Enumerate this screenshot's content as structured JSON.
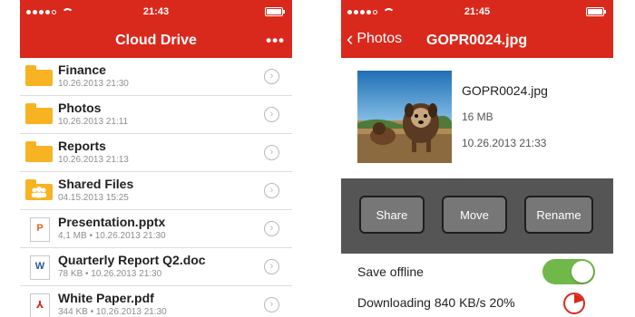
{
  "colors": {
    "accent": "#d9291c",
    "folder": "#f7b321",
    "toggle_on": "#71b84a",
    "action_bar": "#555555"
  },
  "left_screen": {
    "status": {
      "time": "21:43"
    },
    "nav": {
      "title": "Cloud Drive",
      "more_icon": "ellipsis-icon",
      "more_text": "•••"
    },
    "items": [
      {
        "name": "Finance",
        "meta": "10.26.2013 21:30",
        "icon": "folder-icon"
      },
      {
        "name": "Photos",
        "meta": "10.26.2013 21:11",
        "icon": "folder-icon"
      },
      {
        "name": "Reports",
        "meta": "10.26.2013 21:13",
        "icon": "folder-icon"
      },
      {
        "name": "Shared Files",
        "meta": "04.15.2013 15:25",
        "icon": "shared-folder-icon"
      },
      {
        "name": "Presentation.pptx",
        "meta": "4,1 MB • 10.26.2013 21:30",
        "icon": "powerpoint-file-icon",
        "badge": "P",
        "badge_color": "#e0621f"
      },
      {
        "name": "Quarterly Report Q2.doc",
        "meta": "78 KB • 10.26.2013 21:30",
        "icon": "word-file-icon",
        "badge": "W",
        "badge_color": "#2a5699"
      },
      {
        "name": "White Paper.pdf",
        "meta": "344 KB • 10.26.2013 21:30",
        "icon": "pdf-file-icon",
        "badge": "⅄",
        "badge_color": "#d9291c"
      }
    ]
  },
  "right_screen": {
    "status": {
      "time": "21:45"
    },
    "nav": {
      "back_label": "Photos",
      "title": "GOPR0024.jpg"
    },
    "file": {
      "name": "GOPR0024.jpg",
      "size": "16 MB",
      "date": "10.26.2013 21:33"
    },
    "actions": {
      "share": "Share",
      "move": "Move",
      "rename": "Rename"
    },
    "save_offline": {
      "label": "Save offline",
      "enabled": true
    },
    "download": {
      "label": "Downloading 840 KB/s 20%",
      "progress": 0.2
    }
  }
}
